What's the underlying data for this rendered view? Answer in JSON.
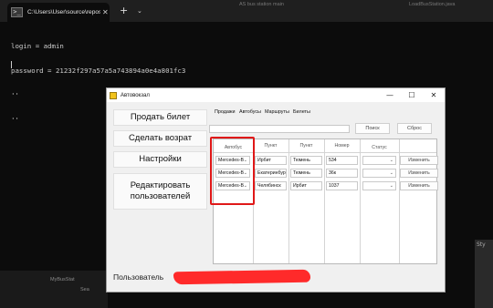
{
  "terminal": {
    "tab_title": "C:\\Users\\User\\source\\repos\\A",
    "tab_icon": "terminal-icon",
    "add_tab": "+",
    "dropdown": "⌄",
    "lines": [
      "login = admin",
      "password = 21232f297a57a5a743894a0e4a801fc3",
      "''",
      "''"
    ]
  },
  "background": {
    "top_text_1": "AS bus station main",
    "top_text_2": "LoadBusStation.java",
    "right_text": "Sty",
    "bottom_text": "MyBusStat",
    "bottom_text_2": "Sea"
  },
  "window": {
    "title": "Автовокзал",
    "minimize": "—",
    "maximize": "☐",
    "close": "✕"
  },
  "left_panel": {
    "buttons": [
      "Продать билет",
      "Сделать возрат",
      "Настройки",
      "Редактировать пользователей"
    ],
    "user_label": "Пользователь"
  },
  "menu": [
    "Продажи",
    "Автобусы",
    "Маршруты",
    "Билеты"
  ],
  "search": {
    "value": "",
    "search_button": "Поиск",
    "reset_button": "Сброс"
  },
  "grid": {
    "headers": [
      "Автобус",
      "Пункт",
      "Пункт",
      "Номер",
      "Статус",
      ""
    ],
    "rows": [
      {
        "bus": "Mercedes-B",
        "from": "Ирбит",
        "to": "Тюмень",
        "number": "534",
        "status": "",
        "action": "Изменить"
      },
      {
        "bus": "Mercedes-B",
        "from": "Екатеринбург",
        "to": "Тюмень",
        "number": "36к",
        "status": "",
        "action": "Изменить"
      },
      {
        "bus": "Mercedes-B",
        "from": "Челябинск",
        "to": "Ирбит",
        "number": "1037",
        "status": "",
        "action": "Изменить"
      }
    ]
  },
  "colors": {
    "accent_red": "#e01818",
    "redaction": "#ff2a2a",
    "terminal_bg": "#0c0c0c"
  }
}
